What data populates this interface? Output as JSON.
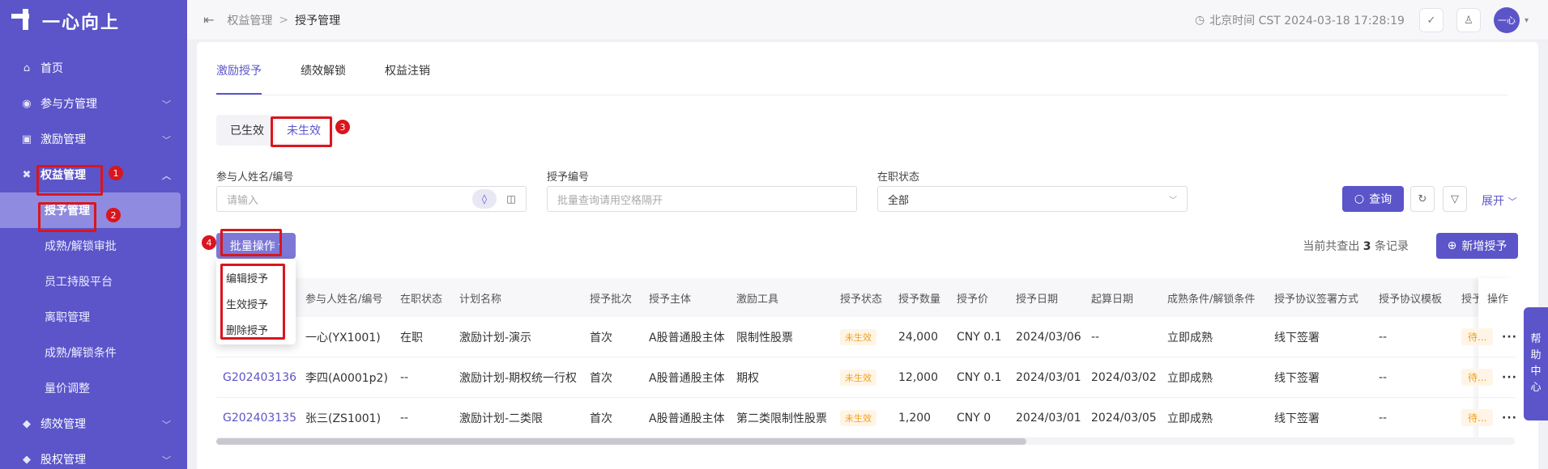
{
  "sidebar": {
    "logo": "一心向上",
    "items": [
      {
        "label": "首页",
        "icon": "home-icon",
        "glyph": "⌂"
      },
      {
        "label": "参与方管理",
        "icon": "users-icon",
        "glyph": "◉"
      },
      {
        "label": "激励管理",
        "icon": "incentive-icon",
        "glyph": "▣"
      },
      {
        "label": "权益管理",
        "icon": "rights-icon",
        "glyph": "✖"
      },
      {
        "label": "绩效管理",
        "icon": "performance-icon",
        "glyph": "◆"
      },
      {
        "label": "股权管理",
        "icon": "equity-icon",
        "glyph": "◆"
      }
    ],
    "sub_items": [
      "授予管理",
      "成熟/解锁审批",
      "员工持股平台",
      "离职管理",
      "成熟/解锁条件",
      "量价调整"
    ]
  },
  "header": {
    "breadcrumb": [
      "权益管理",
      "授予管理"
    ],
    "clock": "北京时间 CST 2024-03-18 17:28:19",
    "avatar": "一心"
  },
  "tabs": [
    "激励授予",
    "绩效解锁",
    "权益注销"
  ],
  "segment": [
    "已生效",
    "未生效"
  ],
  "filters": {
    "name_label": "参与人姓名/编号",
    "name_placeholder": "请输入",
    "grant_label": "授予编号",
    "grant_placeholder": "批量查询请用空格隔开",
    "status_label": "在职状态",
    "status_value": "全部"
  },
  "actions": {
    "query": "查询",
    "expand": "展开",
    "batch": "批量操作",
    "add": "新增授予",
    "record_prefix": "当前共查出",
    "record_count": "3",
    "record_suffix": "条记录"
  },
  "dropdown": [
    "编辑授予",
    "生效授予",
    "删除授予"
  ],
  "table": {
    "columns": [
      "参与人姓名/编号",
      "在职状态",
      "计划名称",
      "授予批次",
      "授予主体",
      "激励工具",
      "授予状态",
      "授予数量",
      "授予价",
      "授予日期",
      "起算日期",
      "成熟条件/解锁条件",
      "授予协议签署方式",
      "授予协议模板",
      "授予",
      "操作"
    ],
    "rows": [
      {
        "grant_no": "",
        "name": "一心(YX1001)",
        "status": "在职",
        "plan": "激励计划-演示",
        "batch": "首次",
        "entity": "A股普通股主体",
        "tool": "限制性股票",
        "state": "未生效",
        "qty": "24,000",
        "price": "CNY  0.1",
        "date": "2024/03/06",
        "start": "--",
        "cond": "立即成熟",
        "sign": "线下签署",
        "tpl": "--",
        "extra": "待..."
      },
      {
        "grant_no": "G202403136",
        "name": "李四(A0001p2)",
        "status": "--",
        "plan": "激励计划-期权统一行权",
        "batch": "首次",
        "entity": "A股普通股主体",
        "tool": "期权",
        "state": "未生效",
        "qty": "12,000",
        "price": "CNY  0.1",
        "date": "2024/03/01",
        "start": "2024/03/02",
        "cond": "立即成熟",
        "sign": "线下签署",
        "tpl": "--",
        "extra": "待..."
      },
      {
        "grant_no": "G202403135",
        "name": "张三(ZS1001)",
        "status": "--",
        "plan": "激励计划-二类限",
        "batch": "首次",
        "entity": "A股普通股主体",
        "tool": "第二类限制性股票",
        "state": "未生效",
        "qty": "1,200",
        "price": "CNY  0",
        "date": "2024/03/01",
        "start": "2024/03/05",
        "cond": "立即成熟",
        "sign": "线下签署",
        "tpl": "--",
        "extra": "待..."
      }
    ]
  },
  "annotations": [
    "1",
    "2",
    "3",
    "4"
  ],
  "help": [
    "帮",
    "助",
    "中",
    "心"
  ],
  "colors": {
    "brand": "#5b55c9",
    "highlight": "#d9161d",
    "pending": "#f0a020"
  }
}
